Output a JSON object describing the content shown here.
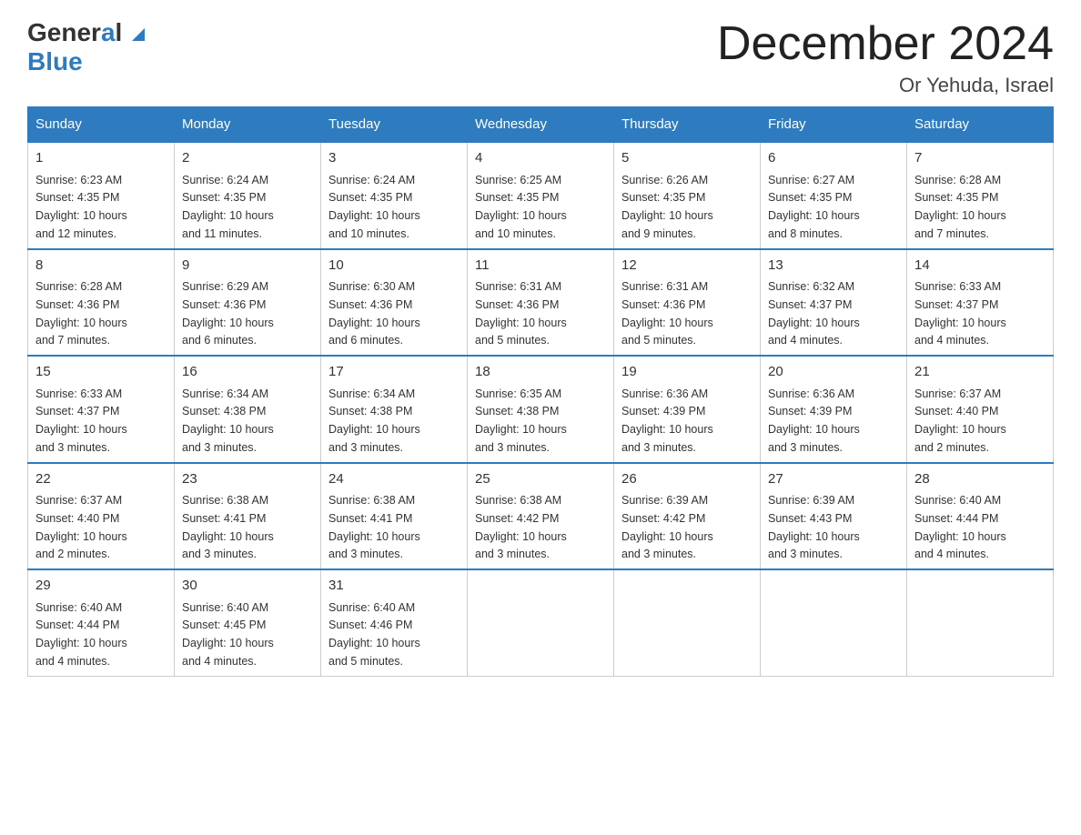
{
  "header": {
    "logo_general": "General",
    "logo_blue": "Blue",
    "month_title": "December 2024",
    "subtitle": "Or Yehuda, Israel"
  },
  "days_of_week": [
    "Sunday",
    "Monday",
    "Tuesday",
    "Wednesday",
    "Thursday",
    "Friday",
    "Saturday"
  ],
  "weeks": [
    [
      {
        "day": "1",
        "sunrise": "6:23 AM",
        "sunset": "4:35 PM",
        "daylight": "10 hours and 12 minutes."
      },
      {
        "day": "2",
        "sunrise": "6:24 AM",
        "sunset": "4:35 PM",
        "daylight": "10 hours and 11 minutes."
      },
      {
        "day": "3",
        "sunrise": "6:24 AM",
        "sunset": "4:35 PM",
        "daylight": "10 hours and 10 minutes."
      },
      {
        "day": "4",
        "sunrise": "6:25 AM",
        "sunset": "4:35 PM",
        "daylight": "10 hours and 10 minutes."
      },
      {
        "day": "5",
        "sunrise": "6:26 AM",
        "sunset": "4:35 PM",
        "daylight": "10 hours and 9 minutes."
      },
      {
        "day": "6",
        "sunrise": "6:27 AM",
        "sunset": "4:35 PM",
        "daylight": "10 hours and 8 minutes."
      },
      {
        "day": "7",
        "sunrise": "6:28 AM",
        "sunset": "4:35 PM",
        "daylight": "10 hours and 7 minutes."
      }
    ],
    [
      {
        "day": "8",
        "sunrise": "6:28 AM",
        "sunset": "4:36 PM",
        "daylight": "10 hours and 7 minutes."
      },
      {
        "day": "9",
        "sunrise": "6:29 AM",
        "sunset": "4:36 PM",
        "daylight": "10 hours and 6 minutes."
      },
      {
        "day": "10",
        "sunrise": "6:30 AM",
        "sunset": "4:36 PM",
        "daylight": "10 hours and 6 minutes."
      },
      {
        "day": "11",
        "sunrise": "6:31 AM",
        "sunset": "4:36 PM",
        "daylight": "10 hours and 5 minutes."
      },
      {
        "day": "12",
        "sunrise": "6:31 AM",
        "sunset": "4:36 PM",
        "daylight": "10 hours and 5 minutes."
      },
      {
        "day": "13",
        "sunrise": "6:32 AM",
        "sunset": "4:37 PM",
        "daylight": "10 hours and 4 minutes."
      },
      {
        "day": "14",
        "sunrise": "6:33 AM",
        "sunset": "4:37 PM",
        "daylight": "10 hours and 4 minutes."
      }
    ],
    [
      {
        "day": "15",
        "sunrise": "6:33 AM",
        "sunset": "4:37 PM",
        "daylight": "10 hours and 3 minutes."
      },
      {
        "day": "16",
        "sunrise": "6:34 AM",
        "sunset": "4:38 PM",
        "daylight": "10 hours and 3 minutes."
      },
      {
        "day": "17",
        "sunrise": "6:34 AM",
        "sunset": "4:38 PM",
        "daylight": "10 hours and 3 minutes."
      },
      {
        "day": "18",
        "sunrise": "6:35 AM",
        "sunset": "4:38 PM",
        "daylight": "10 hours and 3 minutes."
      },
      {
        "day": "19",
        "sunrise": "6:36 AM",
        "sunset": "4:39 PM",
        "daylight": "10 hours and 3 minutes."
      },
      {
        "day": "20",
        "sunrise": "6:36 AM",
        "sunset": "4:39 PM",
        "daylight": "10 hours and 3 minutes."
      },
      {
        "day": "21",
        "sunrise": "6:37 AM",
        "sunset": "4:40 PM",
        "daylight": "10 hours and 2 minutes."
      }
    ],
    [
      {
        "day": "22",
        "sunrise": "6:37 AM",
        "sunset": "4:40 PM",
        "daylight": "10 hours and 2 minutes."
      },
      {
        "day": "23",
        "sunrise": "6:38 AM",
        "sunset": "4:41 PM",
        "daylight": "10 hours and 3 minutes."
      },
      {
        "day": "24",
        "sunrise": "6:38 AM",
        "sunset": "4:41 PM",
        "daylight": "10 hours and 3 minutes."
      },
      {
        "day": "25",
        "sunrise": "6:38 AM",
        "sunset": "4:42 PM",
        "daylight": "10 hours and 3 minutes."
      },
      {
        "day": "26",
        "sunrise": "6:39 AM",
        "sunset": "4:42 PM",
        "daylight": "10 hours and 3 minutes."
      },
      {
        "day": "27",
        "sunrise": "6:39 AM",
        "sunset": "4:43 PM",
        "daylight": "10 hours and 3 minutes."
      },
      {
        "day": "28",
        "sunrise": "6:40 AM",
        "sunset": "4:44 PM",
        "daylight": "10 hours and 4 minutes."
      }
    ],
    [
      {
        "day": "29",
        "sunrise": "6:40 AM",
        "sunset": "4:44 PM",
        "daylight": "10 hours and 4 minutes."
      },
      {
        "day": "30",
        "sunrise": "6:40 AM",
        "sunset": "4:45 PM",
        "daylight": "10 hours and 4 minutes."
      },
      {
        "day": "31",
        "sunrise": "6:40 AM",
        "sunset": "4:46 PM",
        "daylight": "10 hours and 5 minutes."
      },
      null,
      null,
      null,
      null
    ]
  ],
  "labels": {
    "sunrise": "Sunrise:",
    "sunset": "Sunset:",
    "daylight": "Daylight:"
  },
  "colors": {
    "header_bg": "#2e7bbf",
    "header_text": "#ffffff",
    "border": "#2e7bbf"
  }
}
